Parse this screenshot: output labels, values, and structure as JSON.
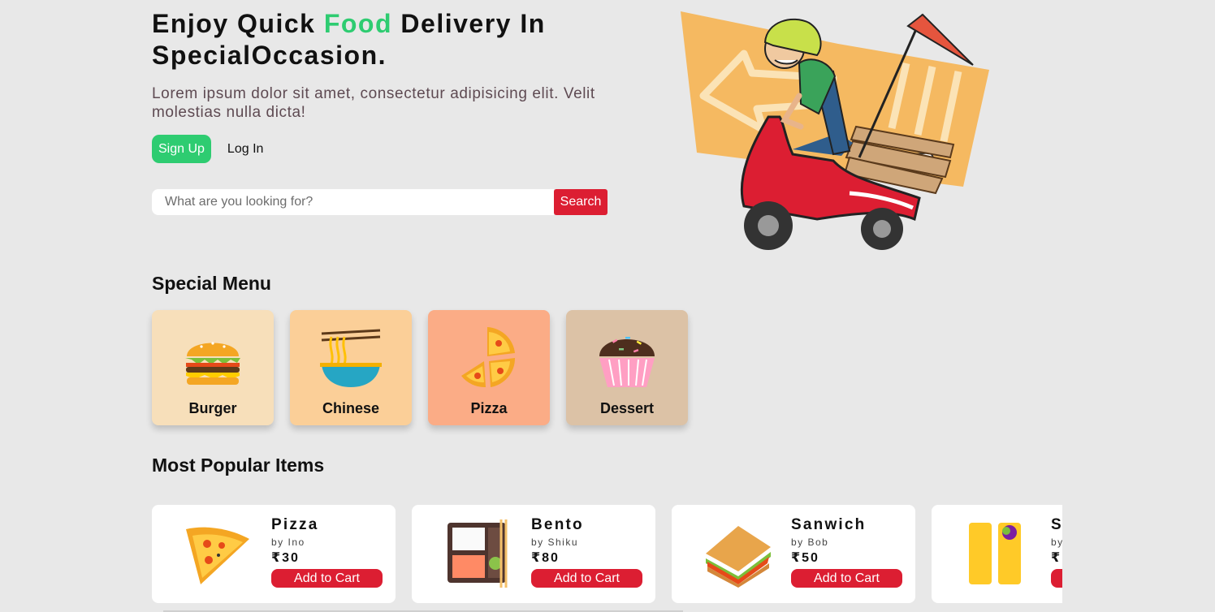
{
  "hero": {
    "title_before": "Enjoy Quick ",
    "title_accent": "Food",
    "title_after": " Delivery In",
    "title_line2": "SpecialOccasion.",
    "subtitle": "Lorem ipsum dolor sit amet, consectetur adipisicing elit. Velit molestias nulla dicta!",
    "signup_label": "Sign Up",
    "login_label": "Log In",
    "search_placeholder": "What are you looking for?",
    "search_label": "Search"
  },
  "special_menu": {
    "title": "Special Menu",
    "items": [
      {
        "label": "Burger",
        "icon": "burger-icon",
        "color": "#f7dfba"
      },
      {
        "label": "Chinese",
        "icon": "noodles-icon",
        "color": "#fbcf98"
      },
      {
        "label": "Pizza",
        "icon": "pizza-icon",
        "color": "#fbac86"
      },
      {
        "label": "Dessert",
        "icon": "cupcake-icon",
        "color": "#dcc2a6"
      }
    ]
  },
  "popular": {
    "title": "Most Popular Items",
    "items": [
      {
        "name": "Pizza",
        "by": "by Ino",
        "price": "₹30",
        "cart_label": "Add to Cart",
        "icon": "pizza-slice-icon"
      },
      {
        "name": "Bento",
        "by": "by Shiku",
        "price": "₹80",
        "cart_label": "Add to Cart",
        "icon": "bento-icon"
      },
      {
        "name": "Sanwich",
        "by": "by Bob",
        "price": "₹50",
        "cart_label": "Add to Cart",
        "icon": "sandwich-icon"
      },
      {
        "name": "S",
        "by": "by",
        "price": "₹",
        "cart_label": "",
        "icon": "wrap-icon"
      }
    ]
  },
  "colors": {
    "accent_green": "#2ecc71",
    "accent_red": "#dc1e32",
    "background": "#e8e8e8"
  }
}
